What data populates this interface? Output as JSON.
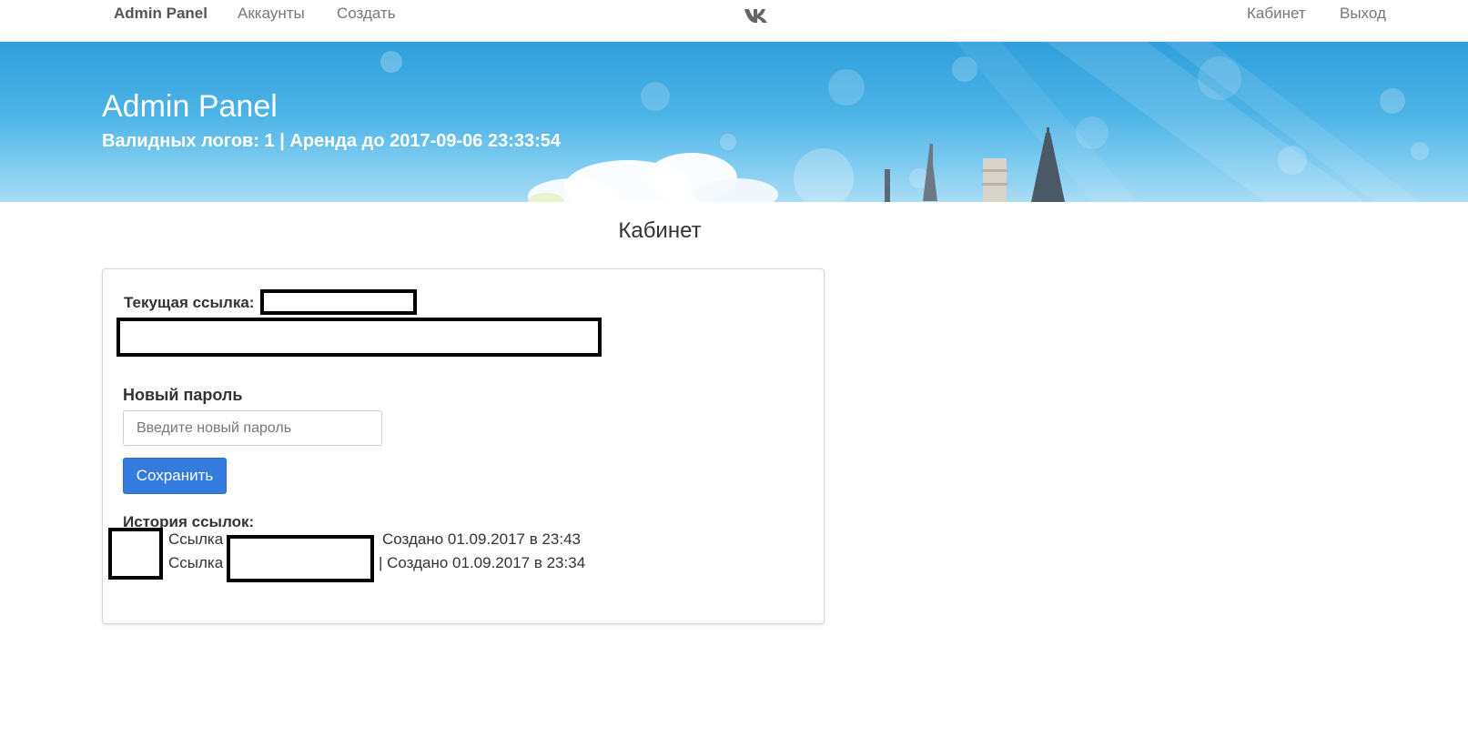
{
  "navbar": {
    "brand": "Admin Panel",
    "links_left": [
      "Аккаунты",
      "Создать"
    ],
    "logo_icon": "vk-logo-icon",
    "links_right": [
      "Кабинет",
      "Выход"
    ]
  },
  "hero": {
    "title": "Admin Panel",
    "subtitle": "Валидных логов: 1 | Аренда до 2017-09-06 23:33:54"
  },
  "page": {
    "title": "Кабинет"
  },
  "card": {
    "current_link_label": "Текущая ссылка:",
    "new_password_label": "Новый пароль",
    "password_placeholder": "Введите новый пароль",
    "save_label": "Сохранить",
    "history_label": "История ссылок:",
    "history": [
      {
        "prefix": "Ссылка",
        "created": "Создано 01.09.2017 в 23:43"
      },
      {
        "prefix": "Ссылка",
        "created": "| Создано 01.09.2017 в 23:34"
      }
    ]
  },
  "colors": {
    "primary_button": "#337bdc",
    "hero_sky": "#4cb3e6",
    "nav_text": "#777777"
  }
}
